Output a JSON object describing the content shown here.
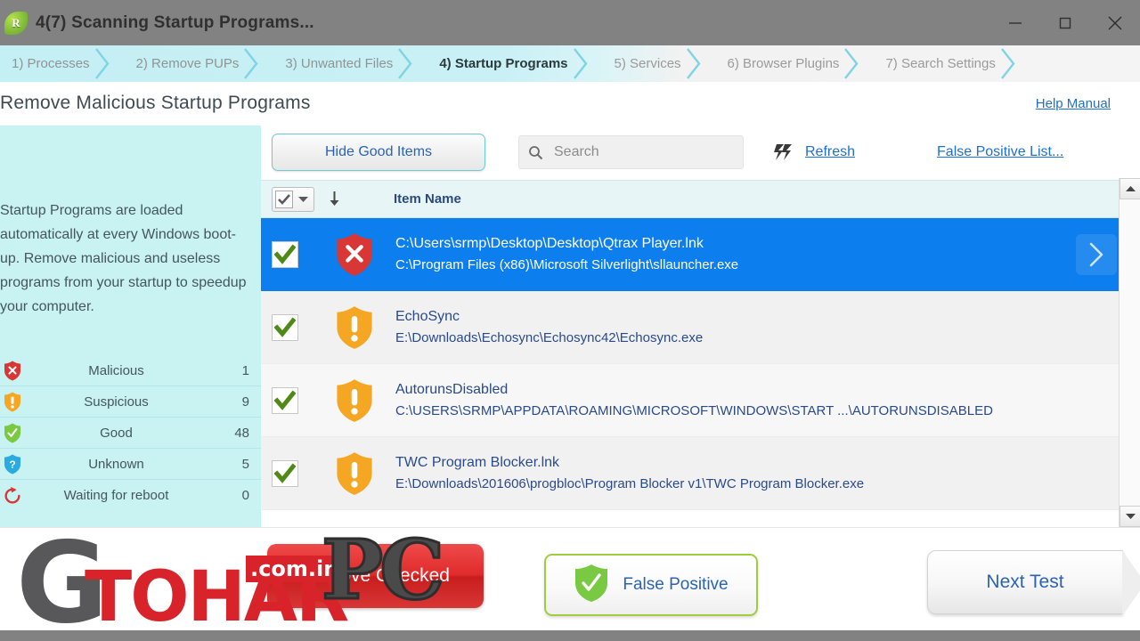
{
  "window": {
    "title": "4(7) Scanning Startup Programs...",
    "app_icon": "leaf-icon",
    "app_icon_letter": "R",
    "minimize_label": "Minimize",
    "maximize_label": "Maximize",
    "close_label": "Close"
  },
  "tabs": [
    {
      "label": "1) Processes",
      "state": "done"
    },
    {
      "label": "2) Remove PUPs",
      "state": "done"
    },
    {
      "label": "3) Unwanted Files",
      "state": "done"
    },
    {
      "label": "4) Startup Programs",
      "state": "active"
    },
    {
      "label": "5) Services",
      "state": "pending"
    },
    {
      "label": "6) Browser Plugins",
      "state": "pending"
    },
    {
      "label": "7) Search Settings",
      "state": "pending"
    }
  ],
  "header": {
    "page_title": "Remove Malicious Startup Programs",
    "help_link": "Help Manual"
  },
  "left_panel": {
    "description": "Startup Programs are loaded automatically at every Windows boot-up. Remove malicious and useless programs from your startup to speedup your computer.",
    "stats": [
      {
        "icon": "shield-malicious-icon",
        "label": "Malicious",
        "value": "1",
        "color": "#d93636"
      },
      {
        "icon": "shield-suspicious-icon",
        "label": "Suspicious",
        "value": "9",
        "color": "#f5a623"
      },
      {
        "icon": "shield-good-icon",
        "label": "Good",
        "value": "48",
        "color": "#7ac943"
      },
      {
        "icon": "shield-unknown-icon",
        "label": "Unknown",
        "value": "5",
        "color": "#29abe2"
      },
      {
        "icon": "reboot-icon",
        "label": "Waiting for reboot",
        "value": "0",
        "color": "#d93636"
      }
    ]
  },
  "toolbar": {
    "hide_good_items_label": "Hide Good Items",
    "search_placeholder": "Search",
    "search_value": "",
    "refresh_label": "Refresh",
    "false_positive_list_label": "False Positive List..."
  },
  "list": {
    "column_item_name": "Item Name",
    "select_all_checked": true,
    "rows": [
      {
        "checked": true,
        "status": "malicious",
        "status_icon": "shield-malicious-icon",
        "name": "C:\\Users\\srmp\\Desktop\\Desktop\\Qtrax Player.lnk",
        "path": "C:\\Program Files (x86)\\Microsoft Silverlight\\sllauncher.exe",
        "selected": true,
        "chevron": "chevron-right-icon"
      },
      {
        "checked": true,
        "status": "suspicious",
        "status_icon": "shield-suspicious-icon",
        "name": "EchoSync",
        "path": "E:\\Downloads\\Echosync\\Echosync42\\Echosync.exe",
        "selected": false,
        "chevron": ""
      },
      {
        "checked": true,
        "status": "suspicious",
        "status_icon": "shield-suspicious-icon",
        "name": "AutorunsDisabled",
        "path": "C:\\USERS\\SRMP\\APPDATA\\ROAMING\\MICROSOFT\\WINDOWS\\START ...\\AUTORUNSDISABLED",
        "selected": false,
        "chevron": ""
      },
      {
        "checked": true,
        "status": "suspicious",
        "status_icon": "shield-suspicious-icon",
        "name": "TWC Program Blocker.lnk",
        "path": "E:\\Downloads\\201606\\progbloc\\Program Blocker v1\\TWC Program Blocker.exe",
        "selected": false,
        "chevron": ""
      }
    ]
  },
  "footer": {
    "remove_checked_label": "Remove Checked",
    "false_positive_label": "False Positive",
    "next_test_label": "Next Test"
  },
  "watermark": {
    "g": "G",
    "tohar": "TOHAR",
    "domain": ".com.in",
    "pc": "PC"
  },
  "colors": {
    "accent_cyan": "#c9f2f2",
    "selection_blue": "#0d7eee",
    "link_blue": "#1f6fd0",
    "malicious_red": "#d93636",
    "suspicious_orange": "#f5a623",
    "good_green": "#7ac943",
    "unknown_blue": "#29abe2",
    "titlebar_gray": "#828282"
  }
}
